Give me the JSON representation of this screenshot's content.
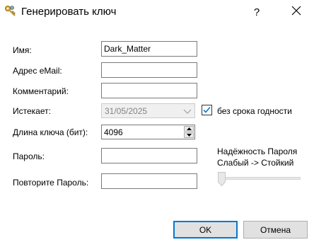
{
  "window": {
    "title": "Генерировать ключ",
    "help_glyph": "?",
    "close_glyph": "✕",
    "icon": "keys-icon"
  },
  "form": {
    "name_label": "Имя:",
    "name_value": "Dark_Matter",
    "email_label": "Адрес eMail:",
    "email_value": "",
    "comment_label": "Комментарий:",
    "comment_value": "",
    "expires_label": "Истекает:",
    "expires_value": "31/05/2025",
    "no_expiry_label": "без срока годности",
    "no_expiry_checked": true,
    "key_length_label": "Длина ключа (бит):",
    "key_length_value": "4096",
    "password_label": "Пароль:",
    "password_value": "",
    "repeat_password_label": "Повторите Пароль:",
    "repeat_password_value": ""
  },
  "strength": {
    "title": "Надёжность Пароля",
    "scale": "Слабый -> Стойкий",
    "level": 0
  },
  "buttons": {
    "ok_label": "OK",
    "cancel_label": "Отмена"
  },
  "colors": {
    "accent": "#0078d7",
    "check": "#0078d7",
    "key_gold": "#d9a521"
  }
}
